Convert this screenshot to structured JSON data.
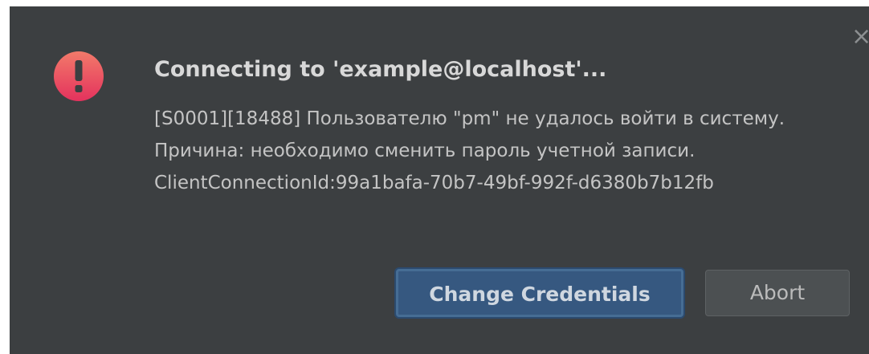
{
  "dialog": {
    "title": "Connecting to 'example@localhost'...",
    "message": "[S0001][18488] Пользователю \"pm\" не удалось войти в систему. Причина: необходимо сменить пароль учетной записи. ClientConnectionId:99a1bafa-70b7-49bf-992f-d6380b7b12fb",
    "close_glyph": "×",
    "icon": "error-exclamation-icon"
  },
  "buttons": {
    "primary_label": "Change Credentials",
    "secondary_label": "Abort"
  },
  "colors": {
    "background": "#3c3f41",
    "icon_top": "#f26d6d",
    "icon_bottom": "#e5365a",
    "primary_button": "#365880",
    "secondary_button": "#4c5052"
  }
}
